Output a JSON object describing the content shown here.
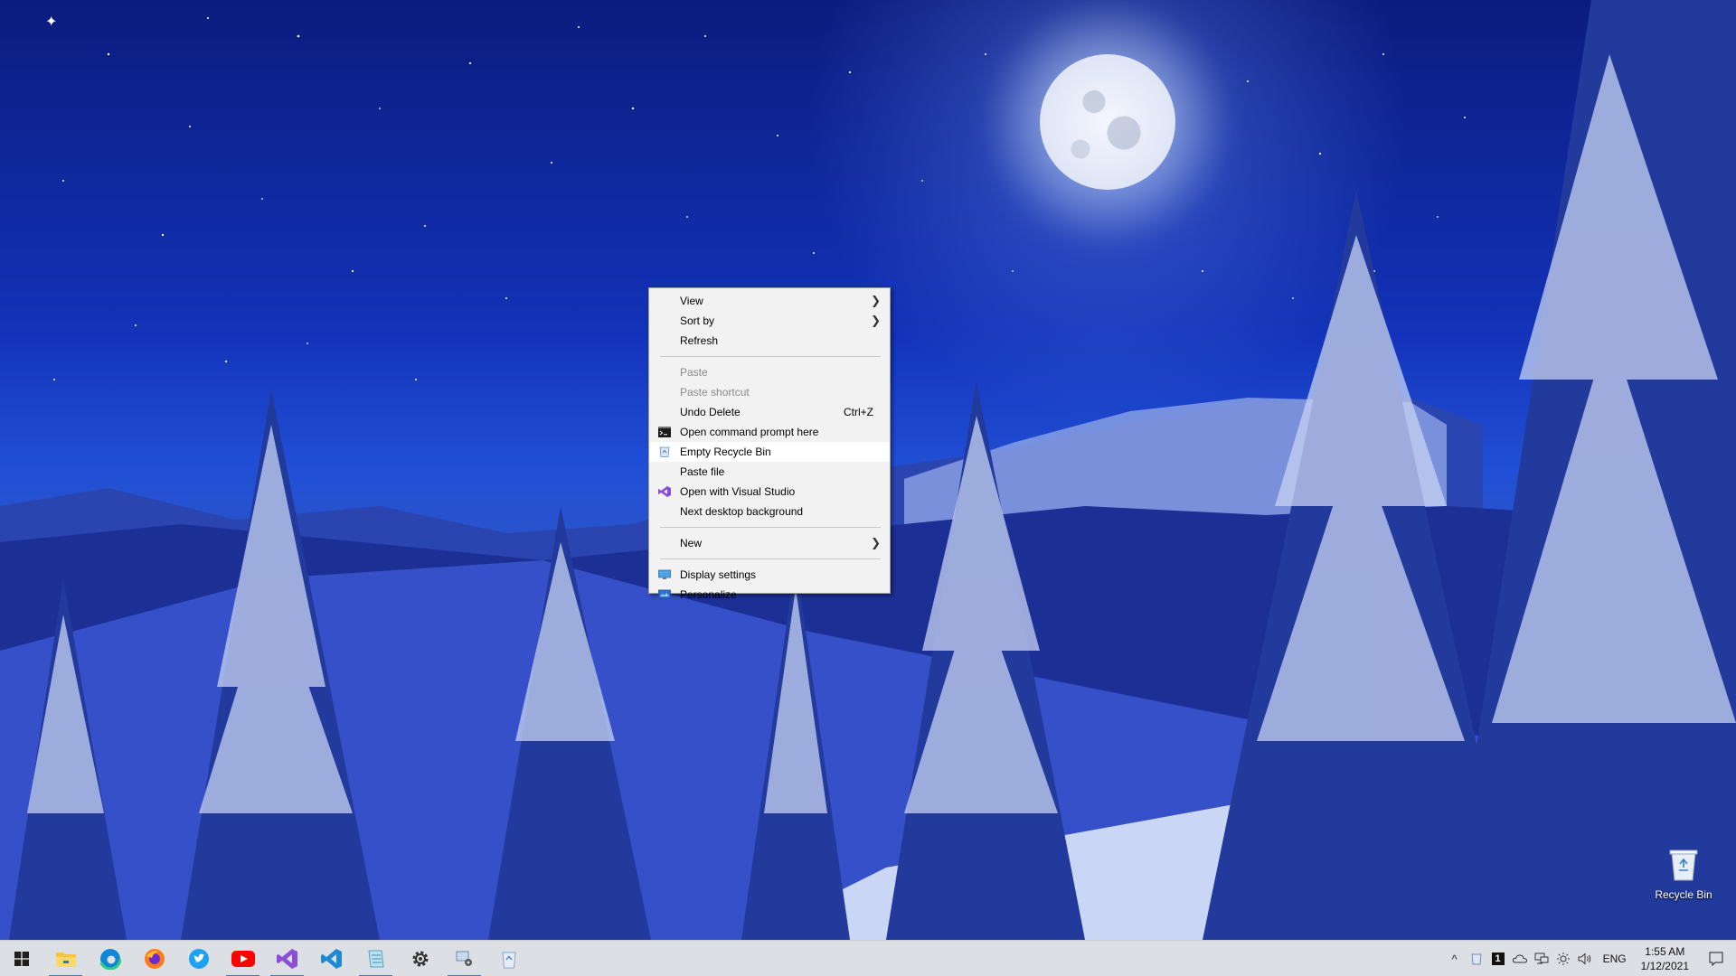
{
  "context_menu": {
    "items": [
      {
        "label": "View",
        "has_submenu": true
      },
      {
        "label": "Sort by",
        "has_submenu": true
      },
      {
        "label": "Refresh"
      },
      {
        "label": "Paste",
        "disabled": true
      },
      {
        "label": "Paste shortcut",
        "disabled": true
      },
      {
        "label": "Undo Delete",
        "shortcut": "Ctrl+Z"
      },
      {
        "label": "Open command prompt here",
        "icon": "command-prompt-icon"
      },
      {
        "label": "Empty Recycle Bin",
        "icon": "recycle-bin-icon",
        "highlighted": true
      },
      {
        "label": "Paste file"
      },
      {
        "label": "Open with Visual Studio",
        "icon": "visual-studio-icon"
      },
      {
        "label": "Next desktop background"
      },
      {
        "label": "New",
        "has_submenu": true
      },
      {
        "label": "Display settings",
        "icon": "display-settings-icon"
      },
      {
        "label": "Personalize",
        "icon": "personalize-icon"
      }
    ],
    "arrow": "❯"
  },
  "desktop": {
    "recycle_bin_label": "Recycle Bin"
  },
  "taskbar": {
    "apps": [
      {
        "name": "file-explorer-icon",
        "running": true
      },
      {
        "name": "edge-icon"
      },
      {
        "name": "firefox-icon"
      },
      {
        "name": "twitter-icon"
      },
      {
        "name": "youtube-icon",
        "running": true
      },
      {
        "name": "visual-studio-icon",
        "running": true
      },
      {
        "name": "vscode-icon"
      },
      {
        "name": "notepad-icon",
        "running": true
      },
      {
        "name": "settings-gear-icon"
      },
      {
        "name": "control-panel-icon",
        "running": true
      },
      {
        "name": "recycle-bin-icon"
      }
    ],
    "tray": {
      "language": "ENG",
      "time": "1:55 AM",
      "date": "1/12/2021",
      "overflow_chevron": "^",
      "badge_number": "1"
    }
  },
  "colors": {
    "accent": "#3a7bd5",
    "menu_bg": "#f2f2f2",
    "taskbar_bg": "#dcdfe4"
  }
}
